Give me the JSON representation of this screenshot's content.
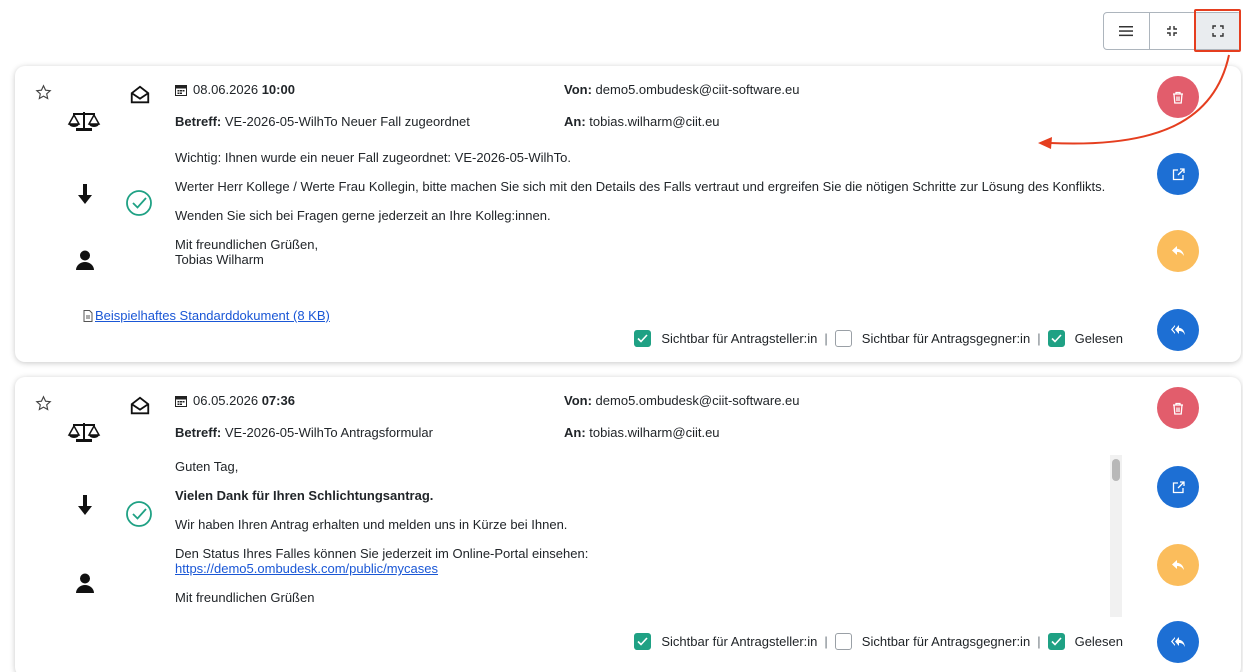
{
  "toolbar": {
    "view_buttons": [
      "list-view-icon",
      "collapse-view-icon",
      "expand-view-icon"
    ],
    "active_view": "expand-view-icon"
  },
  "messages": [
    {
      "date": "08.06.2026",
      "time": "10:00",
      "from_label": "Von:",
      "from": "demo5.ombudesk@ciit-software.eu",
      "subject_label": "Betreff:",
      "subject": "VE-2026-05-WilhTo Neuer Fall zugeordnet",
      "to_label": "An:",
      "to": "tobias.wilharm@ciit.eu",
      "body": [
        "Wichtig: Ihnen wurde ein neuer Fall zugeordnet: VE-2026-05-WilhTo.",
        "Werter Herr Kollege / Werte Frau Kollegin, bitte machen Sie sich mit den Details des Falls vertraut und ergreifen Sie die nötigen Schritte zur Lösung des Konflikts.",
        "Wenden Sie sich bei Fragen gerne jederzeit an Ihre Kolleg:innen.",
        "Mit freundlichen Grüßen,",
        "Tobias Wilharm"
      ],
      "attachment": "Beispielhaftes Standarddokument (8 KB)",
      "flags": [
        {
          "label": "Sichtbar für Antragsteller:in",
          "checked": true
        },
        {
          "label": "Sichtbar für Antragsgegner:in",
          "checked": false
        },
        {
          "label": "Gelesen",
          "checked": true
        }
      ]
    },
    {
      "date": "06.05.2026",
      "time": "07:36",
      "from_label": "Von:",
      "from": "demo5.ombudesk@ciit-software.eu",
      "subject_label": "Betreff:",
      "subject": "VE-2026-05-WilhTo Antragsformular",
      "to_label": "An:",
      "to": "tobias.wilharm@ciit.eu",
      "body": [
        "Guten Tag,",
        "Vielen Dank für Ihren Schlichtungsantrag.",
        "Wir haben Ihren Antrag erhalten und melden uns in Kürze bei Ihnen.",
        "Den Status Ihres Falles können Sie jederzeit im Online-Portal einsehen:",
        "https://demo5.ombudesk.com/public/mycases",
        "Mit freundlichen Grüßen"
      ],
      "flags": [
        {
          "label": "Sichtbar für Antragsteller:in",
          "checked": true
        },
        {
          "label": "Sichtbar für Antragsgegner:in",
          "checked": false
        },
        {
          "label": "Gelesen",
          "checked": true
        }
      ]
    }
  ],
  "colors": {
    "delete": "#e25d6c",
    "open": "#1d6fd4",
    "reply": "#fbbd5c",
    "checked": "#1fa184",
    "annotation": "#e53e1f"
  }
}
